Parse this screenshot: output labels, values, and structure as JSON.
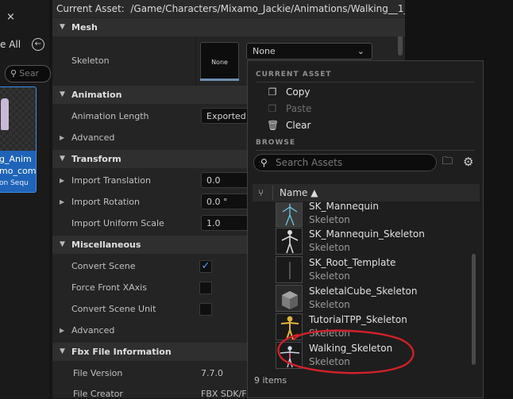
{
  "left_browser": {
    "close_glyph": "×",
    "see_all": "e All",
    "search_placeholder": "Sear",
    "tile_name_line1": "g_Anim",
    "tile_name_line2": "mo_com",
    "tile_type": "on Sequ"
  },
  "details": {
    "current_asset_label": "Current Asset:",
    "current_asset_path": "/Game/Characters/Mixamo_Jackie/Animations/Walking__1_",
    "sections": {
      "mesh": "Mesh",
      "animation": "Animation",
      "transform": "Transform",
      "misc": "Miscellaneous",
      "fbx": "Fbx File Information"
    },
    "skeleton_label": "Skeleton",
    "skeleton_thumb_text": "None",
    "skeleton_value": "None",
    "animation_length_label": "Animation Length",
    "animation_length_value": "Exported T",
    "advanced_label": "Advanced",
    "import_translation_label": "Import Translation",
    "import_translation_value": "0.0",
    "import_rotation_label": "Import Rotation",
    "import_rotation_value": "0.0 °",
    "import_scale_label": "Import Uniform Scale",
    "import_scale_value": "1.0",
    "convert_scene_label": "Convert Scene",
    "convert_scene_checked": true,
    "force_front_label": "Force Front XAxis",
    "convert_unit_label": "Convert Scene Unit",
    "advanced2_label": "Advanced",
    "file_version_label": "File Version",
    "file_version_value": "7.7.0",
    "file_creator_label": "File Creator",
    "file_creator_value": "FBX SDK/FI"
  },
  "picker": {
    "current_asset_heading": "CURRENT ASSET",
    "copy": "Copy",
    "paste": "Paste",
    "clear": "Clear",
    "browse_heading": "BROWSE",
    "search_placeholder": "Search Assets",
    "name_column": "Name ▲",
    "items": [
      {
        "name": "SK_Mannequin",
        "type": "Skeleton"
      },
      {
        "name": "SK_Mannequin_Skeleton",
        "type": "Skeleton"
      },
      {
        "name": "SK_Root_Template",
        "type": "Skeleton"
      },
      {
        "name": "SkeletalCube_Skeleton",
        "type": "Skeleton"
      },
      {
        "name": "TutorialTPP_Skeleton",
        "type": "Skeleton"
      },
      {
        "name": "Walking_Skeleton",
        "type": "Skeleton"
      }
    ],
    "items_count": "9 items"
  },
  "colors": {
    "panel_bg": "#242424",
    "header_bg": "#2f2f2f",
    "accent_blue": "#1f64b8",
    "annotation_red": "#d3202a"
  }
}
